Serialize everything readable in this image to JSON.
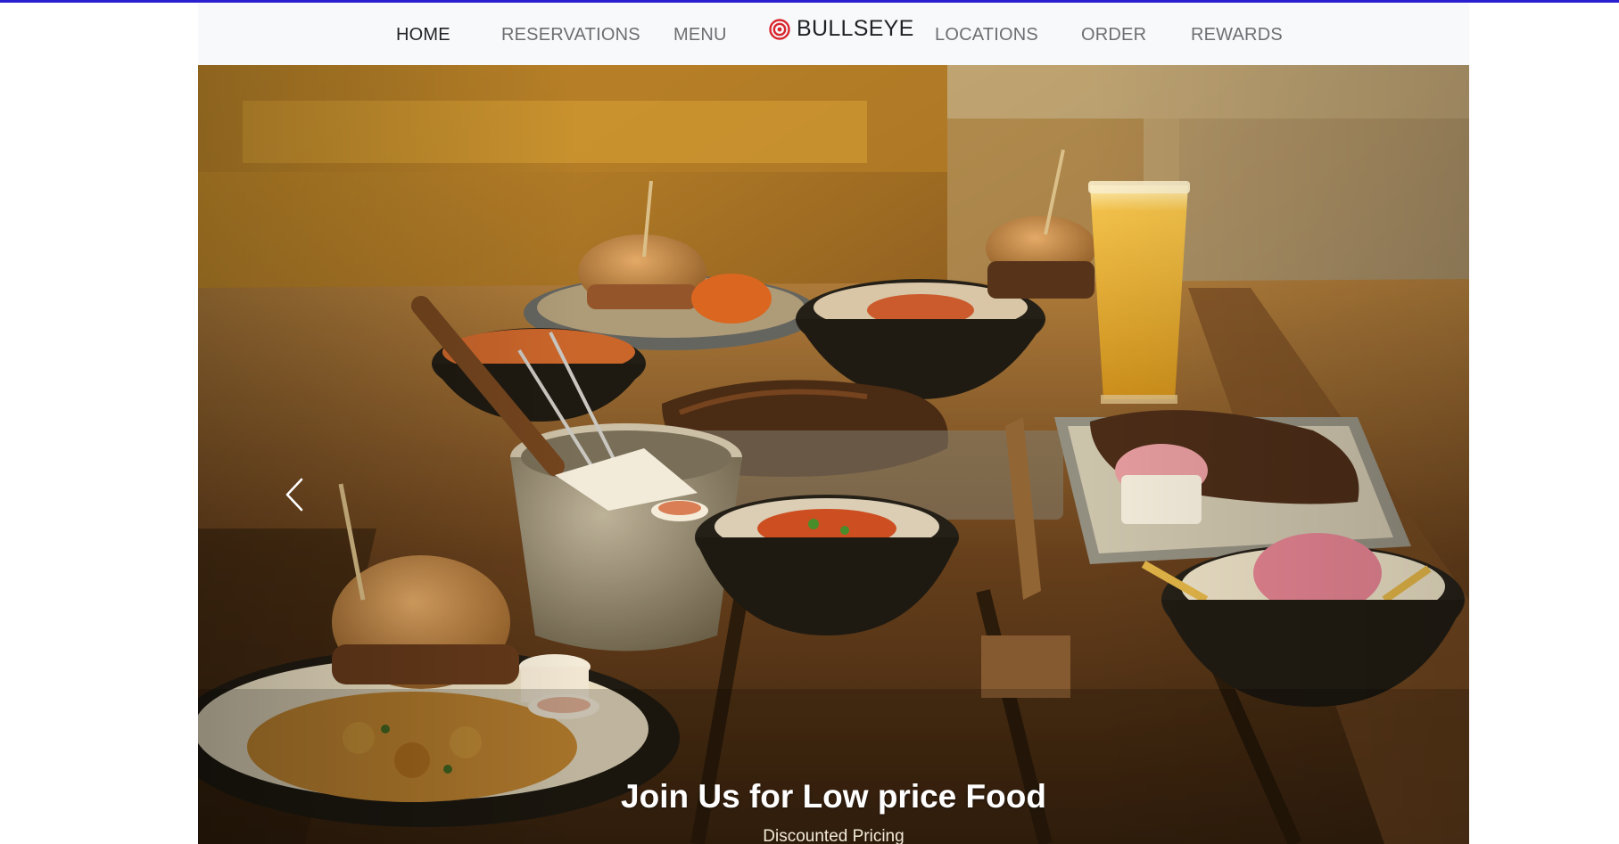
{
  "colors": {
    "top_accent": "#2a1fcf",
    "brand_icon": "#d8262e",
    "nav_background": "#f8f9fa"
  },
  "nav": {
    "left_items": [
      {
        "label": "HOME",
        "active": true
      },
      {
        "label": "RESERVATIONS",
        "active": false
      },
      {
        "label": "MENU",
        "active": false
      }
    ],
    "brand": {
      "name": "BULLSEYE",
      "icon": "bullseye-target-icon"
    },
    "right_items": [
      {
        "label": "LOCATIONS",
        "active": false
      },
      {
        "label": "ORDER",
        "active": false
      },
      {
        "label": "REWARDS",
        "active": false
      }
    ]
  },
  "carousel": {
    "prev_icon": "chevron-left-icon",
    "slide_image": "food-table-photo",
    "caption_title": "Join Us for Low price Food",
    "caption_subtitle": "Discounted Pricing"
  }
}
